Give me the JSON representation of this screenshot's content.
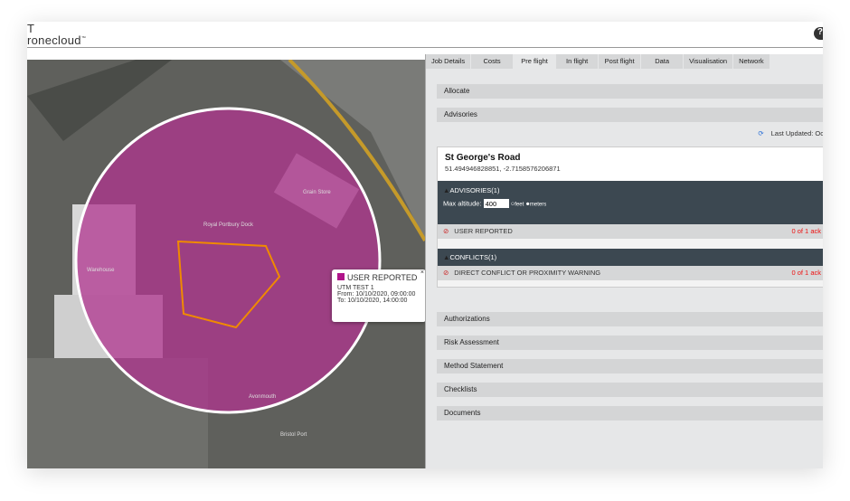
{
  "header": {
    "logo_line1": "T",
    "logo_line2": "ronecloud",
    "logo_tm": "™",
    "help_icon": "?"
  },
  "map": {
    "labels": [
      "Royal Portbury Dock",
      "Warehouse",
      "Grain Store",
      "Bristol Port",
      "Avonmouth"
    ],
    "zone_color": "#b0348f",
    "popup": {
      "title": "USER REPORTED",
      "name": "UTM TEST 1",
      "from": "From: 10/10/2020, 09:00:00",
      "to": "To: 10/10/2020, 14:00:00",
      "close": "×",
      "swatch_color": "#b0148a"
    }
  },
  "tabs": [
    {
      "label": "Job Details"
    },
    {
      "label": "Costs"
    },
    {
      "label": "Pre flight",
      "active": true
    },
    {
      "label": "In flight"
    },
    {
      "label": "Post flight"
    },
    {
      "label": "Data"
    },
    {
      "label": "Visualisation"
    },
    {
      "label": "Network"
    }
  ],
  "sections": {
    "allocate": "Allocate",
    "advisories": "Advisories",
    "authorizations": "Authorizations",
    "risk": "Risk Assessment",
    "method": "Method Statement",
    "checklists": "Checklists",
    "documents": "Documents"
  },
  "last_updated": "Last Updated: Oc",
  "location": {
    "name": "St George's Road",
    "coords": "51.494946828851, -2.7158576206871"
  },
  "advisories": {
    "header": "ADVISORIES(1)",
    "altitude_label": "Max altitude:",
    "altitude_value": "400",
    "unit_feet": "feet",
    "unit_meters": "meters",
    "selected_unit": "meters",
    "items": [
      {
        "label": "USER REPORTED",
        "ack": "0 of 1 ack"
      }
    ]
  },
  "conflicts": {
    "header": "CONFLICTS(1)",
    "items": [
      {
        "label": "DIRECT CONFLICT OR PROXIMITY WARNING",
        "ack": "0 of 1 ack"
      }
    ]
  }
}
